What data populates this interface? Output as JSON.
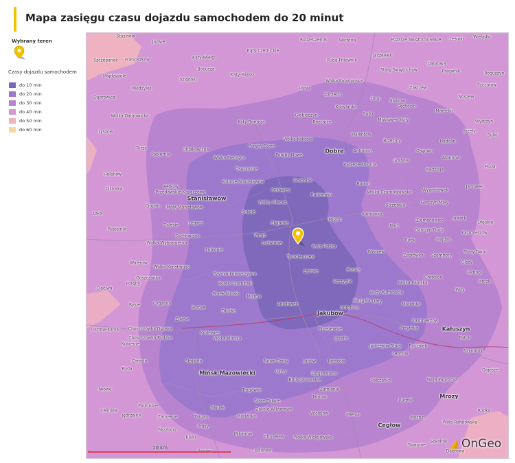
{
  "title": "Mapa zasięgu czasu dojazdu samochodem do 20 minut",
  "legend": {
    "selected_label": "Wybrany teren",
    "heading": "Czasy dojazdu samochodem",
    "items": [
      {
        "label": "do 10 min",
        "color": "#7a66b8"
      },
      {
        "label": "do 20 min",
        "color": "#9a78cc"
      },
      {
        "label": "do 30 min",
        "color": "#b683cf"
      },
      {
        "label": "do 40 min",
        "color": "#d497d6"
      },
      {
        "label": "do 50 min",
        "color": "#f0b3bf"
      },
      {
        "label": "do 60 min",
        "color": "#f7d8a3"
      }
    ]
  },
  "scale_label": "10 km",
  "brand": "OnGeo",
  "places": [
    [
      "Stasinów",
      182,
      52,
      false
    ],
    [
      "Jaźwie",
      230,
      60,
      false
    ],
    [
      "Szczepanek",
      153,
      87,
      false
    ],
    [
      "Franciszków",
      199,
      86,
      false
    ],
    [
      "Kąty-Wielgi",
      296,
      83,
      false
    ],
    [
      "Kąty Czernickie",
      382,
      73,
      false
    ],
    [
      "Ruda-Czernik",
      456,
      57,
      false
    ],
    [
      "Wiktoria",
      505,
      58,
      false
    ],
    [
      "Pożarze Świętochowskie",
      605,
      57,
      false
    ],
    [
      "Leśniki",
      664,
      56,
      false
    ],
    [
      "Wielądki",
      701,
      53,
      false
    ],
    [
      "Międzypole",
      166,
      110,
      false
    ],
    [
      "Bocucza",
      299,
      100,
      false
    ],
    [
      "Szlędaki",
      273,
      115,
      false
    ],
    [
      "Kąty-Miąski",
      352,
      108,
      false
    ],
    [
      "Ruda-Pniewnik",
      497,
      87,
      false
    ],
    [
      "Jaczewek",
      556,
      80,
      false
    ],
    [
      "Dąbrowa",
      635,
      92,
      false
    ],
    [
      "Stary Świętochów",
      580,
      101,
      false
    ],
    [
      "Pniewnik",
      656,
      103,
      false
    ],
    [
      "Roguszyn",
      719,
      106,
      false
    ],
    [
      "Miedzyles",
      205,
      128,
      false
    ],
    [
      "Wólka Kobylańska",
      500,
      117,
      false
    ],
    [
      "Zakrzew",
      608,
      127,
      false
    ],
    [
      "Szczurów",
      708,
      123,
      false
    ],
    [
      "Dąbrowica",
      151,
      141,
      false
    ],
    [
      "Rynia",
      443,
      128,
      false
    ],
    [
      "Zarzecin",
      484,
      137,
      false
    ],
    [
      "Świdów",
      578,
      146,
      false
    ],
    [
      "Drop",
      546,
      143,
      false
    ],
    [
      "Kobylanka",
      503,
      155,
      false
    ],
    [
      "Sęchocin",
      591,
      154,
      false
    ],
    [
      "Noszew",
      678,
      140,
      false
    ],
    [
      "Mareclin",
      646,
      161,
      false
    ],
    [
      "Głębioczyn",
      445,
      167,
      false
    ],
    [
      "Sulki",
      535,
      165,
      false
    ],
    [
      "Wólka Dąbrowicka",
      188,
      168,
      false
    ],
    [
      "Kąty Borucza",
      365,
      177,
      false
    ],
    [
      "Rozcroce",
      468,
      177,
      false
    ],
    [
      "Makówiec Mały",
      572,
      174,
      false
    ],
    [
      "Wydrzyn",
      704,
      176,
      false
    ],
    [
      "Lyszów",
      153,
      191,
      false
    ],
    [
      "Walentów",
      525,
      195,
      false
    ],
    [
      "Józefy",
      683,
      190,
      false
    ],
    [
      "Sulki",
      716,
      196,
      false
    ],
    [
      "Wólka Kokosia",
      433,
      202,
      false
    ],
    [
      "Brzeziny",
      570,
      204,
      false
    ],
    [
      "Nadolin",
      651,
      205,
      false
    ],
    [
      "Turze",
      205,
      215,
      false
    ],
    [
      "Dobre",
      486,
      219,
      true
    ],
    [
      "Poręby Stare",
      380,
      212,
      false
    ],
    [
      "Antonina",
      527,
      219,
      false
    ],
    [
      "Osęowo",
      617,
      219,
      false
    ],
    [
      "Papiernia",
      233,
      224,
      false
    ],
    [
      "Oldakowizna",
      284,
      217,
      false
    ],
    [
      "Poręby Nowe",
      420,
      225,
      false
    ],
    [
      "Adamów",
      656,
      229,
      false
    ],
    [
      "Wólka Pieczęca",
      333,
      229,
      false
    ],
    [
      "Rąbieże-Kolonia",
      523,
      239,
      false
    ],
    [
      "Grabów",
      583,
      233,
      false
    ],
    [
      "Nadziaja",
      632,
      246,
      false
    ],
    [
      "Helenów",
      163,
      253,
      false
    ],
    [
      "Osęczyzna",
      358,
      245,
      false
    ],
    [
      "Ruda",
      713,
      242,
      false
    ],
    [
      "Kolonie Stanisławów",
      353,
      264,
      false
    ],
    [
      "Grabniak",
      440,
      262,
      false
    ],
    [
      "Rudno",
      528,
      267,
      false
    ],
    [
      "Wólka Czarnogłowska",
      566,
      279,
      false
    ],
    [
      "Wygiedowek",
      633,
      276,
      false
    ],
    [
      "Janówek",
      690,
      271,
      false
    ],
    [
      "Cisowka",
      165,
      274,
      false
    ],
    [
      "Retków",
      248,
      271,
      false
    ],
    [
      "Przedawskie Kopaczewo",
      262,
      279,
      false
    ],
    [
      "Rekówiec",
      408,
      276,
      false
    ],
    [
      "Rudzienko",
      467,
      283,
      false
    ],
    [
      "Stanisławów",
      300,
      288,
      true
    ],
    [
      "Wólka Mlecka",
      396,
      294,
      false
    ],
    [
      "Strzebula",
      575,
      298,
      false
    ],
    [
      "Garczyn Mały",
      632,
      294,
      false
    ],
    [
      "Ciopan",
      221,
      299,
      false
    ],
    [
      "Mały Stanisławów",
      268,
      301,
      false
    ],
    [
      "Sokolé",
      361,
      308,
      false
    ],
    [
      "Łaka",
      141,
      310,
      false
    ],
    [
      "Kamionka",
      541,
      311,
      false
    ],
    [
      "Jowork",
      668,
      317,
      false
    ],
    [
      "Ziemenowice",
      625,
      320,
      false
    ],
    [
      "Ołęjane",
      706,
      323,
      false
    ],
    [
      "Zalesie",
      248,
      327,
      false
    ],
    [
      "Legacz",
      284,
      324,
      false
    ],
    [
      "Głęjanka",
      406,
      324,
      false
    ],
    [
      "Mlęcin",
      487,
      319,
      false
    ],
    [
      "Nart",
      573,
      328,
      false
    ],
    [
      "Garczyn Duży",
      624,
      334,
      false
    ],
    [
      "Kazimierzów",
      690,
      338,
      false
    ],
    [
      "Pustelnik",
      169,
      333,
      false
    ],
    [
      "Suchowizna",
      272,
      343,
      false
    ],
    [
      "Porąb",
      378,
      342,
      false
    ],
    [
      "Turek",
      596,
      349,
      false
    ],
    [
      "Majdan",
      645,
      348,
      false
    ],
    [
      "Wólka Wybraniecka",
      242,
      353,
      false
    ],
    [
      "Ludwinów",
      395,
      353,
      false
    ],
    [
      "Wola Polska",
      471,
      358,
      false
    ],
    [
      "Łubionie",
      311,
      363,
      false
    ],
    [
      "Wiśniew",
      547,
      366,
      false
    ],
    [
      "Żebrówka",
      601,
      371,
      false
    ],
    [
      "Szembory",
      642,
      371,
      false
    ],
    [
      "Stary Dwór",
      691,
      366,
      false
    ],
    [
      "Tymoteuszew",
      437,
      373,
      false
    ],
    [
      "Walerów",
      201,
      382,
      false
    ],
    [
      "Wólka Konstancja",
      249,
      388,
      false
    ],
    [
      "Olszy",
      679,
      381,
      false
    ],
    [
      "Szymankowszczyzna",
      341,
      398,
      false
    ],
    [
      "Łaziska",
      452,
      394,
      false
    ],
    [
      "Brzóza",
      514,
      392,
      false
    ],
    [
      "Falbogi",
      690,
      396,
      false
    ],
    [
      "Goszczańka",
      215,
      404,
      false
    ],
    [
      "Chrósice",
      630,
      403,
      false
    ],
    [
      "Wólka Kałuska",
      600,
      411,
      false
    ],
    [
      "Mrozki",
      705,
      409,
      false
    ],
    [
      "Cięciwa",
      151,
      419,
      false
    ],
    [
      "Poręby",
      193,
      412,
      false
    ],
    [
      "Borek Czarniński",
      342,
      412,
      false
    ],
    [
      "Szczyglik",
      498,
      409,
      false
    ],
    [
      "Budy Kuminskie",
      562,
      425,
      false
    ],
    [
      "Wity",
      669,
      421,
      false
    ],
    [
      "Borek Miński",
      328,
      427,
      false
    ],
    [
      "Mistów",
      369,
      431,
      false
    ],
    [
      "Dóry",
      548,
      438,
      false
    ],
    [
      "Marlanka",
      598,
      442,
      false
    ],
    [
      "Rysie",
      195,
      443,
      false
    ],
    [
      "Cyganka",
      235,
      441,
      false
    ],
    [
      "Brzózé",
      288,
      447,
      false
    ],
    [
      "Dłużka",
      332,
      452,
      false
    ],
    [
      "Aniołówek",
      418,
      442,
      false
    ],
    [
      "Jakubów",
      480,
      455,
      true
    ],
    [
      "Mozgała",
      526,
      437,
      false
    ],
    [
      "Antonina",
      508,
      447,
      false
    ],
    [
      "Kazimierzów",
      618,
      466,
      false
    ],
    [
      "Żuków",
      264,
      464,
      false
    ],
    [
      "Przedewsie",
      480,
      478,
      false
    ],
    [
      "Kałuszyn",
      663,
      478,
      true
    ],
    [
      "Przytoka",
      595,
      477,
      false
    ],
    [
      "Ostrów-Kania",
      152,
      479,
      false
    ],
    [
      "Choszczówka Dębska",
      218,
      478,
      false
    ],
    [
      "Królewiec",
      305,
      484,
      false
    ],
    [
      "Józefin",
      496,
      492,
      false
    ],
    [
      "Patok",
      676,
      491,
      false
    ],
    [
      "Choszczówka Rudzka",
      218,
      491,
      false
    ],
    [
      "Wólka Mińska",
      330,
      492,
      false
    ],
    [
      "Jędrzejów Stary",
      560,
      503,
      false
    ],
    [
      "Ryczołek",
      608,
      503,
      false
    ],
    [
      "Kobierne",
      189,
      500,
      false
    ],
    [
      "Leonów",
      582,
      514,
      false
    ],
    [
      "Szymony",
      688,
      510,
      false
    ],
    [
      "Chrośle",
      202,
      525,
      false
    ],
    [
      "Stojadła",
      281,
      525,
      false
    ],
    [
      "Nowe Osiny",
      401,
      525,
      false
    ],
    [
      "Janów",
      450,
      525,
      false
    ],
    [
      "Ignaców",
      489,
      525,
      false
    ],
    [
      "Ruda",
      184,
      536,
      false
    ],
    [
      "Mińsk Mazowiecki",
      330,
      542,
      true
    ],
    [
      "Osiny",
      408,
      540,
      false
    ],
    [
      "Dziękowizna",
      471,
      543,
      false
    ],
    [
      "Gajosze",
      713,
      538,
      false
    ],
    [
      "Wola Papromia",
      643,
      552,
      false
    ],
    [
      "Budy Janowskie",
      443,
      552,
      false
    ],
    [
      "Pełczanka",
      554,
      553,
      false
    ],
    [
      "Iwowe",
      152,
      566,
      false
    ],
    [
      "Targówka",
      366,
      567,
      false
    ],
    [
      "Zamienie",
      479,
      566,
      false
    ],
    [
      "Tabrów",
      464,
      577,
      false
    ],
    [
      "Mrozy",
      653,
      576,
      true
    ],
    [
      "Rudnik",
      590,
      582,
      false
    ],
    [
      "Stare Zakole",
      388,
      583,
      false
    ],
    [
      "Podrudzie",
      215,
      590,
      false
    ],
    [
      "Celiniów",
      158,
      597,
      false
    ],
    [
      "Gliniak",
      316,
      593,
      false
    ],
    [
      "Zakole Wiktorowo",
      398,
      595,
      false
    ],
    [
      "Wiciejów",
      464,
      601,
      false
    ],
    [
      "Rudka",
      704,
      597,
      false
    ],
    [
      "Jędrzejnik",
      191,
      604,
      false
    ],
    [
      "Zamienie",
      243,
      606,
      false
    ],
    [
      "Targan",
      292,
      606,
      false
    ],
    [
      "Marianka",
      358,
      605,
      false
    ],
    [
      "Mienia",
      513,
      603,
      false
    ],
    [
      "Wozbin",
      607,
      607,
      false
    ],
    [
      "Wola Rafałowska",
      669,
      614,
      false
    ],
    [
      "Cegłów",
      566,
      618,
      true
    ],
    [
      "Prusy",
      295,
      620,
      false
    ],
    [
      "Mizzborz",
      243,
      625,
      false
    ],
    [
      "Kluki",
      277,
      636,
      false
    ],
    [
      "Mikanów",
      353,
      631,
      false
    ],
    [
      "Chmielew",
      398,
      635,
      false
    ],
    [
      "Wólka Wiciejowska",
      455,
      636,
      false
    ],
    [
      "Skwarne",
      606,
      647,
      false
    ],
    [
      "Sokolnik",
      638,
      642,
      false
    ],
    [
      "Ilowiec",
      297,
      656,
      false
    ],
    [
      "Julianów",
      382,
      655,
      false
    ],
    [
      "Dąbrowa",
      662,
      656,
      false
    ]
  ]
}
